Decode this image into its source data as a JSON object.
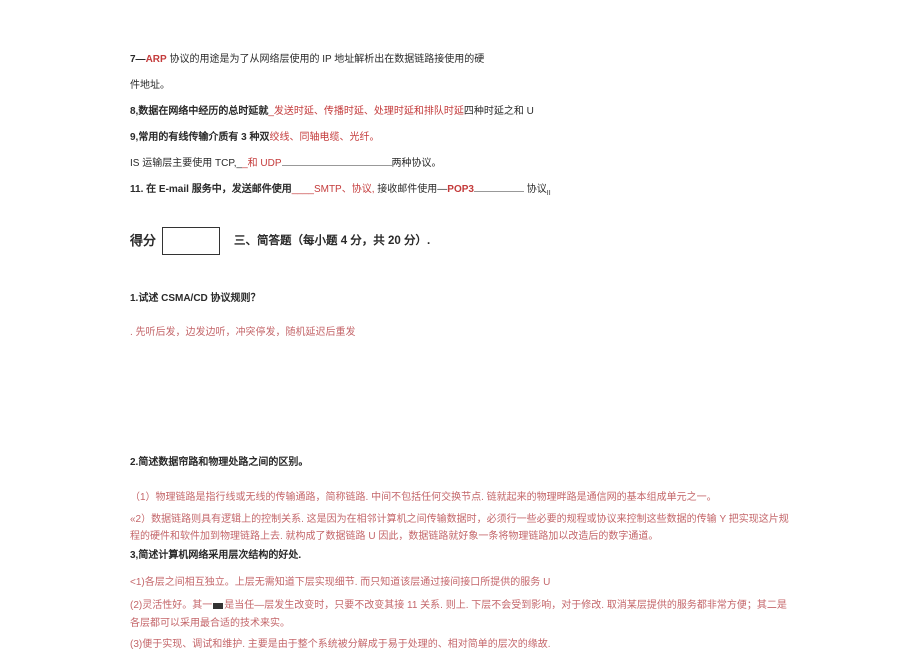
{
  "q7": {
    "prefix": "7—",
    "red": "ARP",
    "rest1": " 协议的用途是为了从网络层使用的 IP 地址解析出在数据链路接使用的硬",
    "rest2": "件地址。"
  },
  "q8": {
    "prefix": "8,数据在网络中经历的总时延就",
    "red": "_发送时延、传播时延、处理时延和排队时延",
    "suffix": "四种时延之和 U"
  },
  "q9": {
    "prefix": "9,常用的有线传输介质有 3 种双",
    "red": "绞线、同轴电缆、光纤。"
  },
  "q10": {
    "prefix": "IS 运输层主要使用 TCP,_",
    "red": "_和 UDP",
    "suffix": "两种协议。"
  },
  "q11": {
    "prefix": "11. 在 E-mail 服务中，发送邮件使用",
    "red1": "____SMTP、协议,",
    "mid": "接收邮件使用—",
    "red2": "POP3",
    "suffix_label": "协议",
    "sub": "II"
  },
  "score_label": "得分",
  "section3_title": "三、简答题（每小题 4 分，共 20 分）.",
  "sa1": {
    "q": "1.试述 CSMA/CD 协议规则？",
    "a": ". 先听后发，边发边听，冲突停发，随机延迟后重发"
  },
  "sa2": {
    "q": "2.简述数据帘路和物理处路之间的区别。",
    "a1": "（1）物理链路是指行线或无线的传输通路，简称链路. 中间不包括任何交换节点. 链就起来的物理畔路是通信网的基本组成单元之一。",
    "a2_pre": "«2）数据链路则具有逻辑上的控制关系. 这是因为在相邻计算机之间传输数据时，必须行一些必要的规程或协议来控制这些数据的传输 Y 把实现这片规程的硬件和软件加到物理链路上去. 就构成了数据链路 U 因此，数据链路就好象一条将物理链路加以改造后的数字通道。"
  },
  "sa3": {
    "q": "3,简述计算机网络采用层次结构的好处.",
    "a1": "<1)各层之间相互独立。上层无需知道下层实现细节. 而只知道该层通过接间接口所提供的服务 U",
    "a2_pre": "(2)灵活性好。其一",
    "a2_post": "是当任—层发生改变时，只要不改变其接 11 关系. 则上. 下层不会受到影响，对于修改. 取消某层提供的服务都非常方便；其二是各层都可以采用最合适的技术来实。",
    "a3": "(3)便于实现、调试和维护. 主要是由于整个系统被分解成于易于处理的、相对简单的层次的缘故."
  }
}
